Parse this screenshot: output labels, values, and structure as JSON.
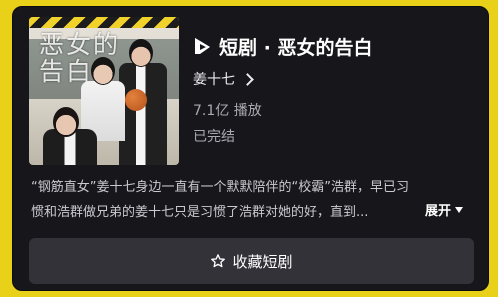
{
  "drama": {
    "title": "短剧 · 恶女的告白",
    "author": "姜十七",
    "plays": "7.1亿 播放",
    "status": "已完结",
    "poster_text": "恶女的告白"
  },
  "description": {
    "line1": "“钢筋直女”姜十七身边一直有一个默默陪伴的“校霸”浩群，早已习",
    "line2": "惯和浩群做兄弟的姜十七只是习惯了浩群对她的好，直到...",
    "expand_label": "展开"
  },
  "actions": {
    "collect_label": "收藏短剧"
  },
  "icons": {
    "drama_logo": "play-logo-icon",
    "author_chevron": "chevron-right-icon",
    "expand_arrow": "caret-down-icon",
    "collect": "star-outline-icon"
  },
  "colors": {
    "frame": "#e9d11a",
    "card": "#17171b",
    "button": "#323238"
  }
}
